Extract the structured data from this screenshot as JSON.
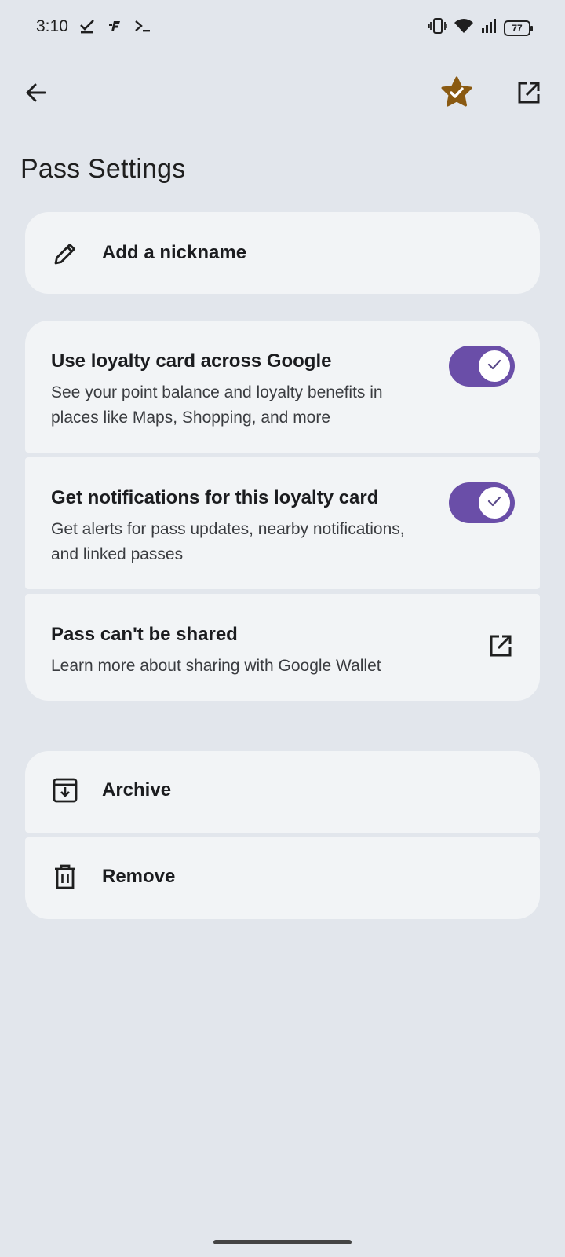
{
  "status_bar": {
    "time": "3:10",
    "battery": "77",
    "left_icons": [
      "check-download-icon",
      "app-f-icon",
      "terminal-icon"
    ],
    "right_icons": [
      "vibrate-icon",
      "wifi-icon",
      "signal-icon",
      "battery-icon"
    ]
  },
  "topbar": {
    "back_icon": "arrow-back-icon",
    "star_icon": "starred-badge-icon",
    "star_color": "#8a5a12",
    "open_icon": "open-in-new-icon"
  },
  "page": {
    "title": "Pass Settings"
  },
  "nickname": {
    "label": "Add a nickname",
    "icon": "pencil-icon"
  },
  "settings": [
    {
      "title": "Use loyalty card across Google",
      "description": "See your point balance and loyalty benefits in places like Maps, Shopping, and more",
      "toggle_on": true
    },
    {
      "title": "Get notifications for this loyalty card",
      "description": "Get alerts for pass updates, nearby notifications, and linked passes",
      "toggle_on": true
    },
    {
      "title": "Pass can't be shared",
      "description": "Learn more about sharing with Google Wallet",
      "icon": "open-in-new-icon"
    }
  ],
  "actions": [
    {
      "label": "Archive",
      "icon": "archive-icon"
    },
    {
      "label": "Remove",
      "icon": "trash-icon"
    }
  ],
  "colors": {
    "background": "#e2e6ec",
    "card": "#f2f4f6",
    "toggle_on": "#6a4ea8"
  }
}
